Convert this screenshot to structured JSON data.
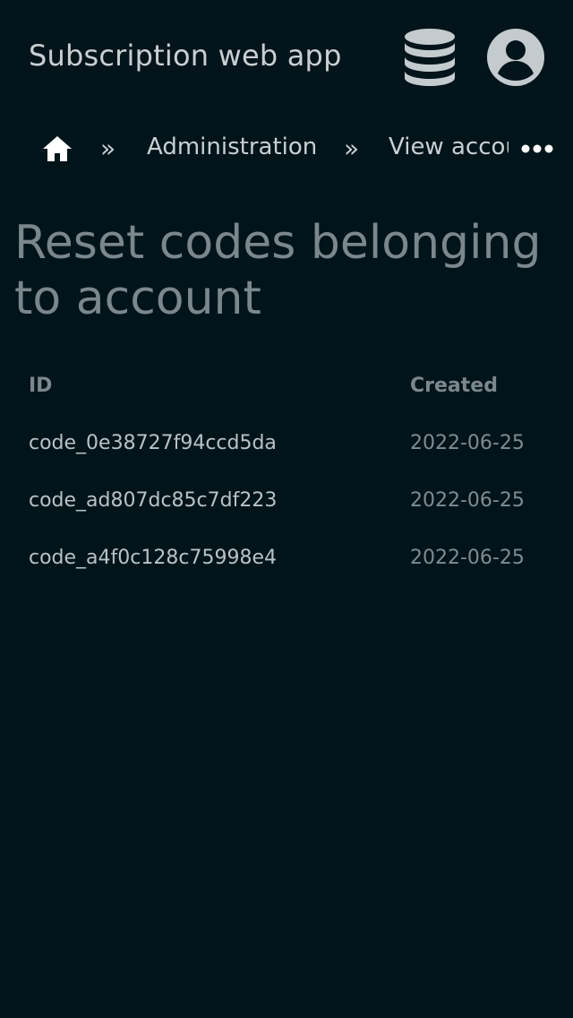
{
  "header": {
    "app_title": "Subscription web app",
    "icons": [
      "database-icon",
      "account-circle-icon"
    ]
  },
  "breadcrumb": {
    "home_icon": "home-icon",
    "separator": "»",
    "items": [
      {
        "label": "Administration"
      },
      {
        "label": "View account"
      }
    ],
    "more_icon": "more-horizontal-icon"
  },
  "page": {
    "title": "Reset codes belonging to account"
  },
  "table": {
    "columns": [
      "ID",
      "Created"
    ],
    "rows": [
      {
        "id": "code_0e38727f94ccd5da",
        "created": "2022-06-25"
      },
      {
        "id": "code_ad807dc85c7df223",
        "created": "2022-06-25"
      },
      {
        "id": "code_a4f0c128c75998e4",
        "created": "2022-06-25"
      }
    ]
  },
  "colors": {
    "background": "#001419",
    "text": "#c8cfd3",
    "muted": "#7a878d"
  }
}
